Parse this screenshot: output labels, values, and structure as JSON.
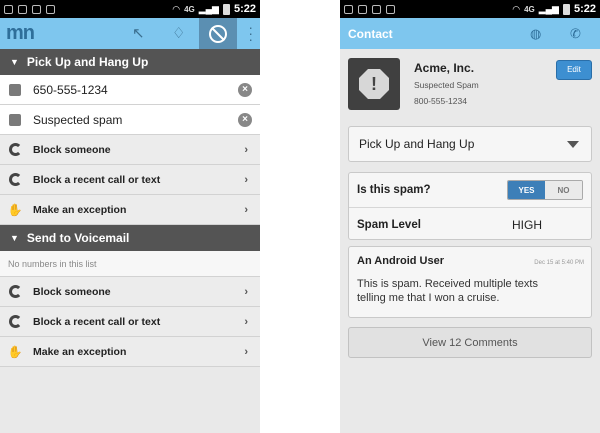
{
  "status_bar": {
    "network": "4G",
    "time": "5:22"
  },
  "left_screen": {
    "sections": [
      {
        "title": "Pick Up and Hang Up",
        "numbers": [
          {
            "label": "650-555-1234",
            "icon": "thumbs-down-icon",
            "clear": "×"
          },
          {
            "label": "Suspected spam",
            "icon": "thumbs-down-icon",
            "clear": "×"
          }
        ],
        "actions": [
          {
            "label": "Block someone",
            "icon": "block-someone-icon"
          },
          {
            "label": "Block a recent call or text",
            "icon": "block-recent-icon"
          },
          {
            "label": "Make an exception",
            "icon": "exception-icon"
          }
        ]
      },
      {
        "title": "Send to Voicemail",
        "empty_text": "No numbers in this list",
        "actions": [
          {
            "label": "Block someone",
            "icon": "block-someone-icon"
          },
          {
            "label": "Block a recent call or text",
            "icon": "block-recent-icon"
          },
          {
            "label": "Make an exception",
            "icon": "exception-icon"
          }
        ]
      }
    ],
    "chevron": "›",
    "section_arrow": "▼"
  },
  "right_screen": {
    "title": "Contact",
    "contact": {
      "name": "Acme, Inc.",
      "subtitle": "Suspected Spam",
      "phone": "800-555-1234",
      "edit_label": "Edit",
      "avatar_symbol": "!"
    },
    "mode_select": {
      "selected": "Pick Up and Hang Up"
    },
    "spam": {
      "question": "Is this spam?",
      "yes": "YES",
      "no": "NO",
      "selected": "yes",
      "level_label": "Spam Level",
      "level_value": "HIGH"
    },
    "comment": {
      "author": "An Android User",
      "date": "Dec 15 at 5:40 PM",
      "text": "This is spam. Received multiple texts telling me that I won a cruise."
    },
    "view_comments_label": "View 12 Comments"
  },
  "colors": {
    "action_bar": "#7ec6ee",
    "section_header": "#545454",
    "accent_blue": "#3d7fb8"
  }
}
